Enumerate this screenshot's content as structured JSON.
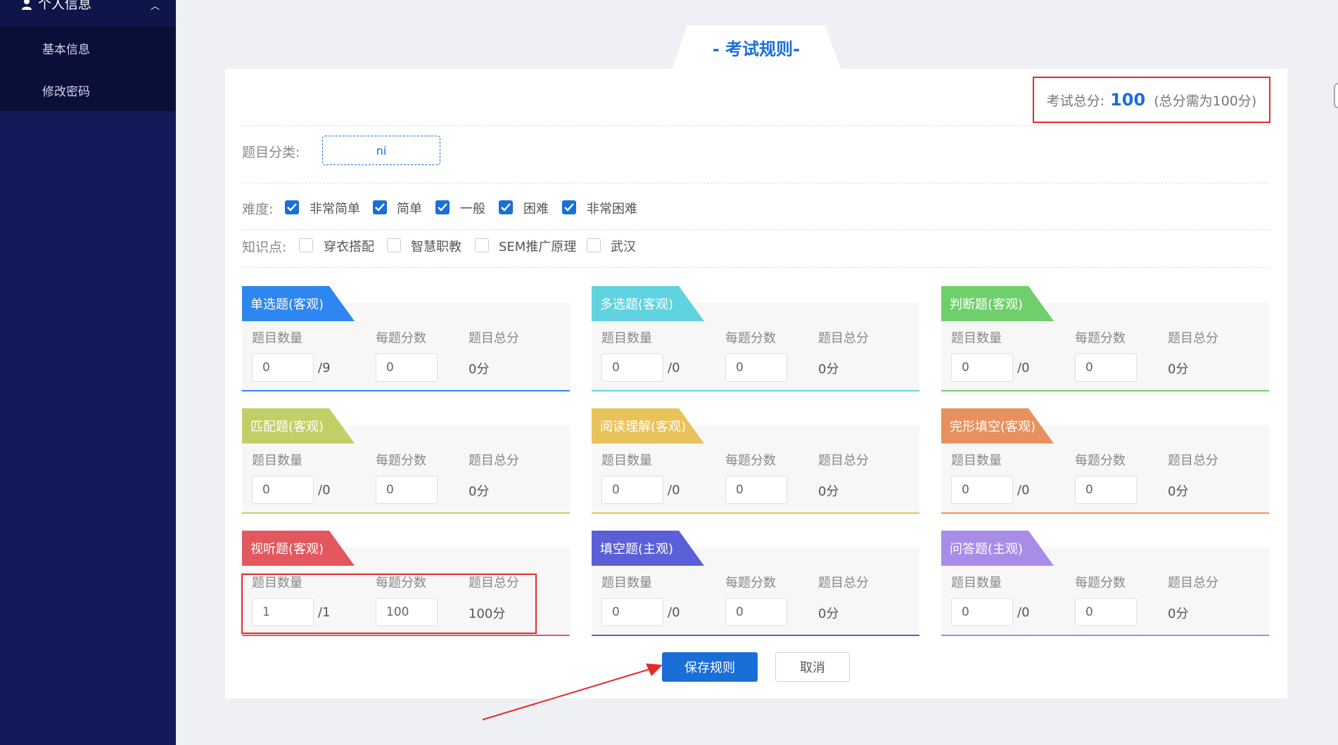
{
  "sidebar": {
    "section_title": "个人信息",
    "items": [
      {
        "label": "基本信息"
      },
      {
        "label": "修改密码"
      }
    ]
  },
  "header": {
    "title": "- 考试规则-"
  },
  "total": {
    "label": "考试总分:",
    "value": "100",
    "note": "(总分需为100分)"
  },
  "category": {
    "label": "题目分类:",
    "value": "ni"
  },
  "difficulty": {
    "label": "难度:",
    "options": [
      {
        "label": "非常简单",
        "checked": true
      },
      {
        "label": "简单",
        "checked": true
      },
      {
        "label": "一般",
        "checked": true
      },
      {
        "label": "困难",
        "checked": true
      },
      {
        "label": "非常困难",
        "checked": true
      }
    ]
  },
  "knowledge": {
    "label": "知识点:",
    "options": [
      {
        "label": "穿衣搭配",
        "checked": false
      },
      {
        "label": "智慧职教",
        "checked": false
      },
      {
        "label": "SEM推广原理",
        "checked": false
      },
      {
        "label": "武汉",
        "checked": false
      }
    ]
  },
  "field_labels": {
    "count": "题目数量",
    "per": "每题分数",
    "total": "题目总分"
  },
  "cards": [
    {
      "title": "单选题(客观)",
      "color": "#2e86f0",
      "count": "0",
      "max": "/9",
      "per": "0",
      "total": "0分"
    },
    {
      "title": "多选题(客观)",
      "color": "#5fd3e0",
      "count": "0",
      "max": "/0",
      "per": "0",
      "total": "0分"
    },
    {
      "title": "判断题(客观)",
      "color": "#6fcf6a",
      "count": "0",
      "max": "/0",
      "per": "0",
      "total": "0分"
    },
    {
      "title": "匹配题(客观)",
      "color": "#c2cf66",
      "count": "0",
      "max": "/0",
      "per": "0",
      "total": "0分"
    },
    {
      "title": "阅读理解(客观)",
      "color": "#e8c25a",
      "count": "0",
      "max": "/0",
      "per": "0",
      "total": "0分"
    },
    {
      "title": "完形填空(客观)",
      "color": "#e8915e",
      "count": "0",
      "max": "/0",
      "per": "0",
      "total": "0分"
    },
    {
      "title": "视听题(客观)",
      "color": "#e2585e",
      "count": "1",
      "max": "/1",
      "per": "100",
      "total": "100分"
    },
    {
      "title": "填空题(主观)",
      "color": "#5b5fd8",
      "count": "0",
      "max": "/0",
      "per": "0",
      "total": "0分"
    },
    {
      "title": "问答题(主观)",
      "color": "#a98ce8",
      "count": "0",
      "max": "/0",
      "per": "0",
      "total": "0分"
    }
  ],
  "buttons": {
    "save": "保存规则",
    "cancel": "取消"
  }
}
